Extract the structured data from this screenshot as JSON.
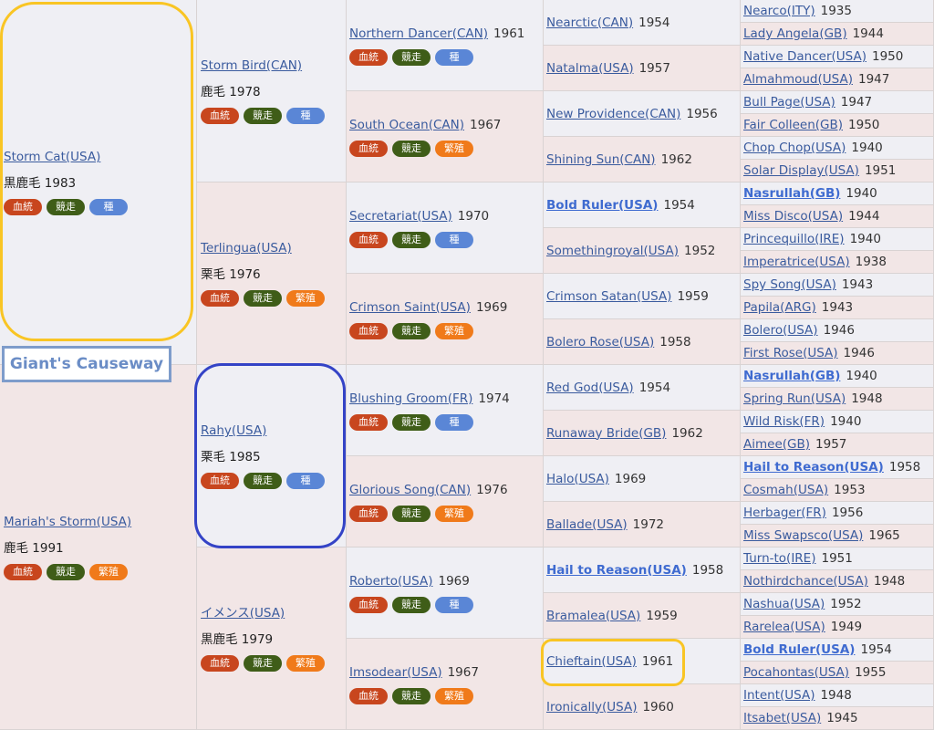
{
  "badges": {
    "blood": "血統",
    "race": "競走",
    "stud": "種",
    "breed": "繁殖"
  },
  "gen1": [
    {
      "name": "Storm Cat(USA)",
      "color": "黒鹿毛 1983",
      "badges": [
        "blood",
        "race",
        "stud"
      ]
    },
    {
      "name": "Mariah's Storm(USA)",
      "color": "鹿毛 1991",
      "badges": [
        "blood",
        "race",
        "breed"
      ]
    }
  ],
  "gen2": [
    {
      "name": "Storm Bird(CAN)",
      "color": "鹿毛 1978",
      "badges": [
        "blood",
        "race",
        "stud"
      ]
    },
    {
      "name": "Terlingua(USA)",
      "color": "栗毛 1976",
      "badges": [
        "blood",
        "race",
        "breed"
      ]
    },
    {
      "name": "Rahy(USA)",
      "color": "栗毛 1985",
      "badges": [
        "blood",
        "race",
        "stud"
      ]
    },
    {
      "name": "イメンス(USA)",
      "color": "黒鹿毛 1979",
      "badges": [
        "blood",
        "race",
        "breed"
      ]
    }
  ],
  "gen3": [
    {
      "name": "Northern Dancer(CAN)",
      "year": "1961",
      "badges": [
        "blood",
        "race",
        "stud"
      ]
    },
    {
      "name": "South Ocean(CAN)",
      "year": "1967",
      "badges": [
        "blood",
        "race",
        "breed"
      ]
    },
    {
      "name": "Secretariat(USA)",
      "year": "1970",
      "badges": [
        "blood",
        "race",
        "stud"
      ]
    },
    {
      "name": "Crimson Saint(USA)",
      "year": "1969",
      "badges": [
        "blood",
        "race",
        "breed"
      ]
    },
    {
      "name": "Blushing Groom(FR)",
      "year": "1974",
      "badges": [
        "blood",
        "race",
        "stud"
      ]
    },
    {
      "name": "Glorious Song(CAN)",
      "year": "1976",
      "badges": [
        "blood",
        "race",
        "breed"
      ]
    },
    {
      "name": "Roberto(USA)",
      "year": "1969",
      "badges": [
        "blood",
        "race",
        "stud"
      ]
    },
    {
      "name": "Imsodear(USA)",
      "year": "1967",
      "badges": [
        "blood",
        "race",
        "breed"
      ]
    }
  ],
  "gen4": [
    {
      "name": "Nearctic(CAN)",
      "year": "1954",
      "bold": false
    },
    {
      "name": "Natalma(USA)",
      "year": "1957",
      "bold": false
    },
    {
      "name": "New Providence(CAN)",
      "year": "1956",
      "bold": false
    },
    {
      "name": "Shining Sun(CAN)",
      "year": "1962",
      "bold": false
    },
    {
      "name": "Bold Ruler(USA)",
      "year": "1954",
      "bold": true
    },
    {
      "name": "Somethingroyal(USA)",
      "year": "1952",
      "bold": false
    },
    {
      "name": "Crimson Satan(USA)",
      "year": "1959",
      "bold": false
    },
    {
      "name": "Bolero Rose(USA)",
      "year": "1958",
      "bold": false
    },
    {
      "name": "Red God(USA)",
      "year": "1954",
      "bold": false
    },
    {
      "name": "Runaway Bride(GB)",
      "year": "1962",
      "bold": false
    },
    {
      "name": "Halo(USA)",
      "year": "1969",
      "bold": false
    },
    {
      "name": "Ballade(USA)",
      "year": "1972",
      "bold": false
    },
    {
      "name": "Hail to Reason(USA)",
      "year": "1958",
      "bold": true
    },
    {
      "name": "Bramalea(USA)",
      "year": "1959",
      "bold": false
    },
    {
      "name": "Chieftain(USA)",
      "year": "1961",
      "bold": false
    },
    {
      "name": "Ironically(USA)",
      "year": "1960",
      "bold": false
    }
  ],
  "gen5": [
    {
      "name": "Nearco(ITY)",
      "year": "1935",
      "bold": false
    },
    {
      "name": "Lady Angela(GB)",
      "year": "1944",
      "bold": false
    },
    {
      "name": "Native Dancer(USA)",
      "year": "1950",
      "bold": false
    },
    {
      "name": "Almahmoud(USA)",
      "year": "1947",
      "bold": false
    },
    {
      "name": "Bull Page(USA)",
      "year": "1947",
      "bold": false
    },
    {
      "name": "Fair Colleen(GB)",
      "year": "1950",
      "bold": false
    },
    {
      "name": "Chop Chop(USA)",
      "year": "1940",
      "bold": false
    },
    {
      "name": "Solar Display(USA)",
      "year": "1951",
      "bold": false
    },
    {
      "name": "Nasrullah(GB)",
      "year": "1940",
      "bold": true
    },
    {
      "name": "Miss Disco(USA)",
      "year": "1944",
      "bold": false
    },
    {
      "name": "Princequillo(IRE)",
      "year": "1940",
      "bold": false
    },
    {
      "name": "Imperatrice(USA)",
      "year": "1938",
      "bold": false
    },
    {
      "name": "Spy Song(USA)",
      "year": "1943",
      "bold": false
    },
    {
      "name": "Papila(ARG)",
      "year": "1943",
      "bold": false
    },
    {
      "name": "Bolero(USA)",
      "year": "1946",
      "bold": false
    },
    {
      "name": "First Rose(USA)",
      "year": "1946",
      "bold": false
    },
    {
      "name": "Nasrullah(GB)",
      "year": "1940",
      "bold": true
    },
    {
      "name": "Spring Run(USA)",
      "year": "1948",
      "bold": false
    },
    {
      "name": "Wild Risk(FR)",
      "year": "1940",
      "bold": false
    },
    {
      "name": "Aimee(GB)",
      "year": "1957",
      "bold": false
    },
    {
      "name": "Hail to Reason(USA)",
      "year": "1958",
      "bold": true
    },
    {
      "name": "Cosmah(USA)",
      "year": "1953",
      "bold": false
    },
    {
      "name": "Herbager(FR)",
      "year": "1956",
      "bold": false
    },
    {
      "name": "Miss Swapsco(USA)",
      "year": "1965",
      "bold": false
    },
    {
      "name": "Turn-to(IRE)",
      "year": "1951",
      "bold": false
    },
    {
      "name": "Nothirdchance(USA)",
      "year": "1948",
      "bold": false
    },
    {
      "name": "Nashua(USA)",
      "year": "1952",
      "bold": false
    },
    {
      "name": "Rarelea(USA)",
      "year": "1949",
      "bold": false
    },
    {
      "name": "Bold Ruler(USA)",
      "year": "1954",
      "bold": true
    },
    {
      "name": "Pocahontas(USA)",
      "year": "1955",
      "bold": false
    },
    {
      "name": "Intent(USA)",
      "year": "1948",
      "bold": false
    },
    {
      "name": "Itsabet(USA)",
      "year": "1945",
      "bold": false
    }
  ],
  "annotation_label": "Giant's Causeway",
  "colors": {
    "male_bg": "#efeff4",
    "female_bg": "#f2e6e6",
    "highlight_yellow": "#f9c524",
    "highlight_blue": "#3443c6",
    "label_blue": "#6b8dc6"
  }
}
